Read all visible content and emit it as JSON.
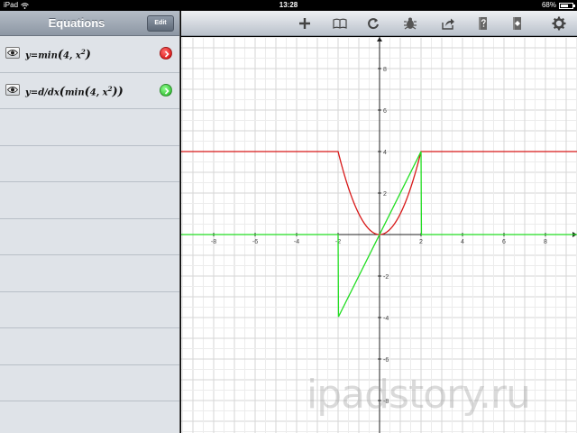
{
  "status": {
    "device": "iPad",
    "time": "13:28",
    "battery": "68%",
    "battery_level": 0.68
  },
  "sidebar": {
    "title": "Equations",
    "edit_label": "Edit",
    "equations": [
      {
        "prefix": "y=min",
        "args": "4, x",
        "exp": "2",
        "suffix": ")",
        "color": "#e02020"
      },
      {
        "prefix": "y=d/dx",
        "inner": "min",
        "args": "4, x",
        "exp": "2",
        "suffix": "))",
        "color": "#22c022"
      }
    ]
  },
  "toolbar": {
    "icons": [
      "plus-icon",
      "book-icon",
      "refresh-icon",
      "bug-icon",
      "share-icon",
      "help-book-icon",
      "info-book-icon",
      "gear-icon"
    ]
  },
  "chart_data": {
    "type": "line",
    "xlim": [
      -9.6,
      9.6
    ],
    "ylim": [
      -9.6,
      9.6
    ],
    "x_ticks": [
      "-8",
      "-6",
      "-4",
      "-2",
      "2",
      "4",
      "6",
      "8"
    ],
    "y_ticks": [
      "8",
      "6",
      "4",
      "2",
      "-2",
      "-4",
      "-6",
      "-8"
    ],
    "grid": true,
    "series": [
      {
        "color": "#d81818"
      },
      {
        "color": "#22dd22"
      }
    ]
  },
  "watermark": "ipadstory.ru"
}
